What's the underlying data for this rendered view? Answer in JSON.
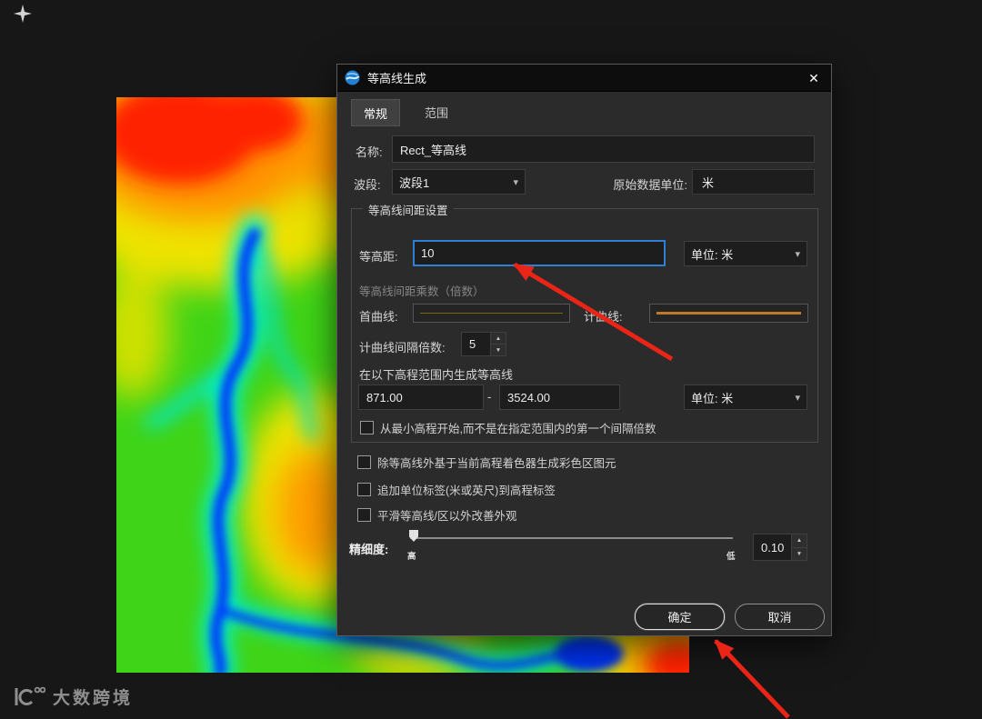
{
  "icons": {
    "chevron": "▾",
    "spin_up": "▲",
    "spin_down": "▼",
    "close": "✕"
  },
  "watermark": {
    "text": "大数跨境"
  },
  "dialog": {
    "title": "等高线生成",
    "tabs": {
      "general": "常规",
      "range": "范围"
    },
    "name_label": "名称:",
    "name_value": "Rect_等高线",
    "band_label": "波段:",
    "band_value": "波段1",
    "source_unit_label": "原始数据单位:",
    "source_unit_value": "米",
    "group": {
      "title": "等高线间距设置",
      "interval_label": "等高距:",
      "interval_value": "10",
      "unit_combo": "单位: 米",
      "multiplier_label": "等高线间距乘数（倍数）",
      "primary_label": "首曲线:",
      "index_label": "计曲线:",
      "index_interval_label": "计曲线间隔倍数:",
      "index_interval_value": "5",
      "range_title": "在以下高程范围内生成等高线",
      "range_min": "871.00",
      "range_separator": "-",
      "range_max": "3524.00",
      "range_unit_combo": "单位: 米",
      "min_start_checkbox": "从最小高程开始,而不是在指定范围内的第一个间隔倍数"
    },
    "options": {
      "color_fill": "除等高线外基于当前高程着色器生成彩色区图元",
      "append_unit": "追加单位标签(米或英尺)到高程标签",
      "smooth": "平滑等高线/区以外改善外观"
    },
    "precision": {
      "label": "精细度:",
      "high": "高",
      "low": "低",
      "value": "0.10"
    },
    "buttons": {
      "ok": "确定",
      "cancel": "取消"
    }
  },
  "colors": {
    "accent": "#2f7fd6",
    "arrow": "#ea2417",
    "primary_line": "#7d6414",
    "index_line": "#c07828"
  }
}
